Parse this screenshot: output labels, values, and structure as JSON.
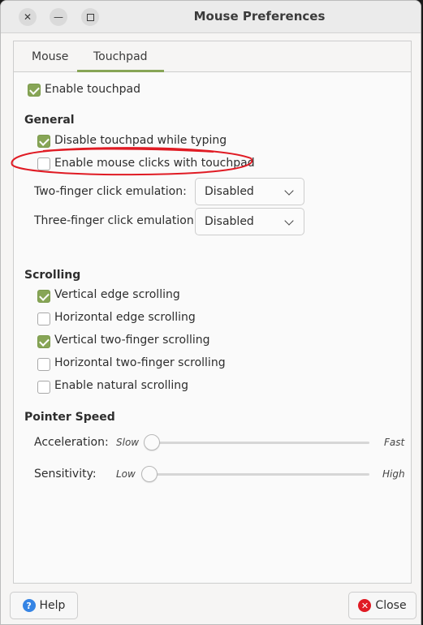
{
  "window": {
    "title": "Mouse Preferences"
  },
  "tabs": [
    {
      "label": "Mouse",
      "active": false
    },
    {
      "label": "Touchpad",
      "active": true
    }
  ],
  "enable_touchpad": {
    "label": "Enable touchpad",
    "checked": true
  },
  "general": {
    "heading": "General",
    "disable_while_typing": {
      "label": "Disable touchpad while typing",
      "checked": true
    },
    "enable_mouse_clicks": {
      "label": "Enable mouse clicks with touchpad",
      "checked": false
    },
    "two_finger": {
      "label": "Two-finger click emulation:",
      "value": "Disabled"
    },
    "three_finger": {
      "label": "Three-finger click emulation:",
      "value": "Disabled"
    }
  },
  "scrolling": {
    "heading": "Scrolling",
    "items": [
      {
        "label": "Vertical edge scrolling",
        "checked": true
      },
      {
        "label": "Horizontal edge scrolling",
        "checked": false
      },
      {
        "label": "Vertical two-finger scrolling",
        "checked": true
      },
      {
        "label": "Horizontal two-finger scrolling",
        "checked": false
      },
      {
        "label": "Enable natural scrolling",
        "checked": false
      }
    ]
  },
  "pointer_speed": {
    "heading": "Pointer Speed",
    "acceleration": {
      "label": "Acceleration:",
      "min_label": "Slow",
      "max_label": "Fast",
      "value": 0.0
    },
    "sensitivity": {
      "label": "Sensitivity:",
      "min_label": "Low",
      "max_label": "High",
      "value": 0.0
    }
  },
  "buttons": {
    "help": "Help",
    "close": "Close"
  },
  "colors": {
    "accent": "#87a556",
    "annotation": "#e01b24"
  }
}
